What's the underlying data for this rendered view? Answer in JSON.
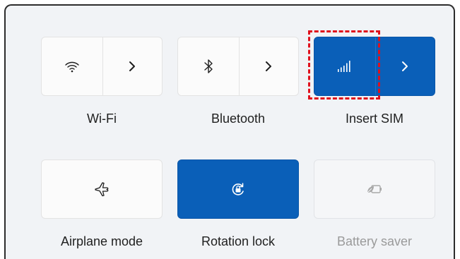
{
  "quick_settings": {
    "tiles": [
      {
        "label": "Wi-Fi",
        "icon": "wifi-icon",
        "state": "off",
        "has_expand": true
      },
      {
        "label": "Bluetooth",
        "icon": "bluetooth-icon",
        "state": "off",
        "has_expand": true
      },
      {
        "label": "Insert SIM",
        "icon": "cellular-signal-icon",
        "state": "on",
        "has_expand": true
      },
      {
        "label": "Airplane mode",
        "icon": "airplane-icon",
        "state": "off",
        "has_expand": false
      },
      {
        "label": "Rotation lock",
        "icon": "rotation-lock-icon",
        "state": "on",
        "has_expand": false
      },
      {
        "label": "Battery saver",
        "icon": "battery-saver-icon",
        "state": "disabled",
        "has_expand": false
      }
    ],
    "expand_icon": "chevron-right-icon",
    "highlight": "cellular-toggle-highlight"
  },
  "colors": {
    "panel_background": "#f1f3f6",
    "tile_background": "#fbfbfb",
    "accent": "#0a5fb8",
    "highlight_border": "#e0101c",
    "label_text": "#1f1f1f",
    "disabled_text": "#9a9a9a"
  }
}
